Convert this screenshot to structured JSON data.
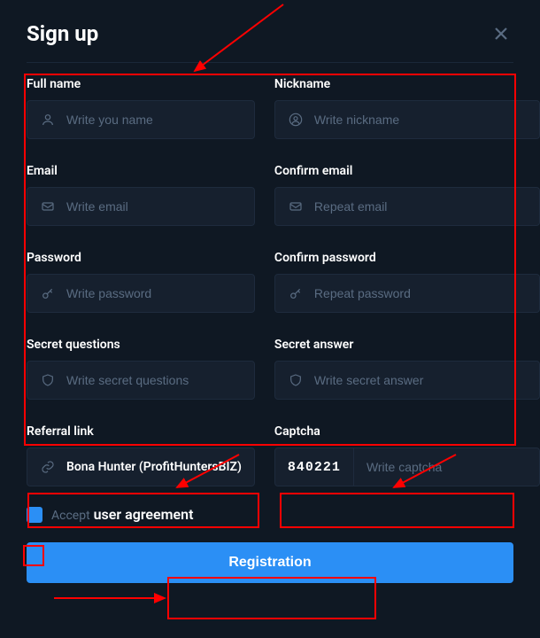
{
  "header": {
    "title": "Sign up"
  },
  "fields": {
    "full_name": {
      "label": "Full name",
      "placeholder": "Write you name"
    },
    "nickname": {
      "label": "Nickname",
      "placeholder": "Write nickname"
    },
    "email": {
      "label": "Email",
      "placeholder": "Write email"
    },
    "confirm_email": {
      "label": "Confirm email",
      "placeholder": "Repeat email"
    },
    "password": {
      "label": "Password",
      "placeholder": "Write password"
    },
    "confirm_password": {
      "label": "Confirm password",
      "placeholder": "Repeat password"
    },
    "secret_questions": {
      "label": "Secret questions",
      "placeholder": "Write secret questions"
    },
    "secret_answer": {
      "label": "Secret answer",
      "placeholder": "Write secret answer"
    },
    "referral": {
      "label": "Referral link",
      "value": "Bona Hunter (ProfitHuntersBIZ)"
    },
    "captcha": {
      "label": "Captcha",
      "code": "840221",
      "placeholder": "Write captcha"
    }
  },
  "agreement": {
    "prefix": "Accept",
    "link_text": "user agreement",
    "checked": true
  },
  "submit": {
    "label": "Registration"
  }
}
